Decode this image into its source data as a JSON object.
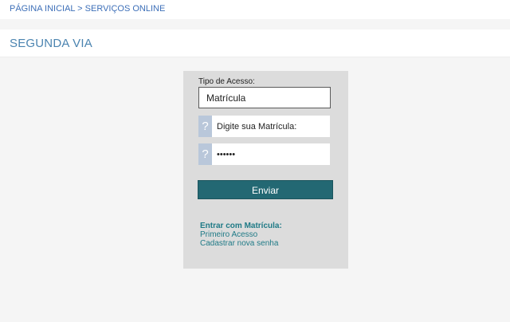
{
  "breadcrumb": {
    "home": "PÁGINA INICIAL",
    "separator": " > ",
    "current": "SERVIÇOS ONLINE"
  },
  "page_title": "SEGUNDA VIA",
  "form": {
    "access_type_label": "Tipo de Acesso:",
    "access_type_value": "Matrícula",
    "matricula_placeholder": "Digite sua Matrícula:",
    "help_glyph": "?",
    "password_value": "••••••",
    "submit_label": "Enviar"
  },
  "links": {
    "heading": "Entrar com Matrícula:",
    "first_access": "Primeiro Acesso",
    "new_password": "Cadastrar nova senha"
  },
  "colors": {
    "accent_blue": "#4b84b0",
    "submit_teal": "#236873",
    "link_teal": "#1f7a86",
    "help_button": "#b9c7da",
    "panel_bg": "#dcdcdc"
  },
  "icons": {
    "help": "question-mark-icon"
  }
}
